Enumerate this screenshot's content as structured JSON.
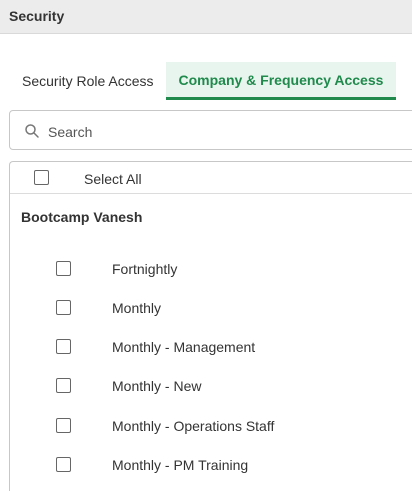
{
  "header": {
    "title": "Security"
  },
  "tabs": [
    {
      "label": "Security Role Access",
      "active": false
    },
    {
      "label": "Company & Frequency Access",
      "active": true
    }
  ],
  "search": {
    "placeholder": "Search",
    "value": ""
  },
  "list": {
    "select_all_label": "Select All",
    "group_title": "Bootcamp Vanesh",
    "items": [
      {
        "label": "Fortnightly",
        "checked": false
      },
      {
        "label": "Monthly",
        "checked": false
      },
      {
        "label": "Monthly - Management",
        "checked": false
      },
      {
        "label": "Monthly - New",
        "checked": false
      },
      {
        "label": "Monthly - Operations Staff",
        "checked": false
      },
      {
        "label": "Monthly - PM Training",
        "checked": false
      }
    ]
  },
  "colors": {
    "accent": "#1f8a4c",
    "active_tab_bg": "#e8f5ee",
    "header_bg": "#ececec"
  },
  "icons": {
    "search": "search-icon"
  }
}
